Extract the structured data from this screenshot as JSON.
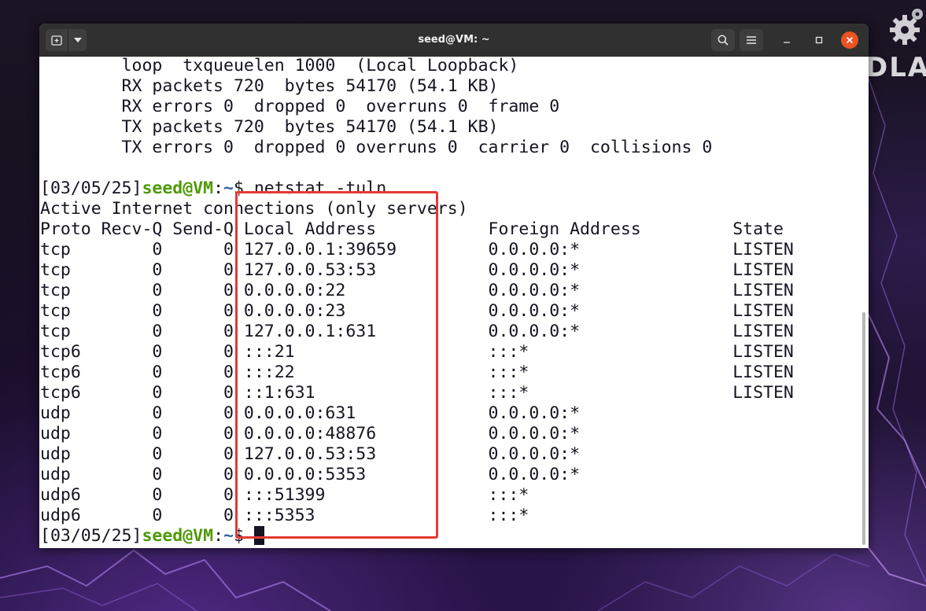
{
  "window": {
    "title": "seed@VM: ~"
  },
  "terminal": {
    "lines": [
      "        loop  txqueuelen 1000  (Local Loopback)",
      "        RX packets 720  bytes 54170 (54.1 KB)",
      "        RX errors 0  dropped 0  overruns 0  frame 0",
      "        TX packets 720  bytes 54170 (54.1 KB)",
      "        TX errors 0  dropped 0 overruns 0  carrier 0  collisions 0",
      "",
      "",
      "Active Internet connections (only servers)",
      "Proto Recv-Q Send-Q Local Address           Foreign Address         State",
      "tcp        0      0 127.0.0.1:39659         0.0.0.0:*               LISTEN",
      "tcp        0      0 127.0.0.53:53           0.0.0.0:*               LISTEN",
      "tcp        0      0 0.0.0.0:22              0.0.0.0:*               LISTEN",
      "tcp        0      0 0.0.0.0:23              0.0.0.0:*               LISTEN",
      "tcp        0      0 127.0.0.1:631           0.0.0.0:*               LISTEN",
      "tcp6       0      0 :::21                   :::*                    LISTEN",
      "tcp6       0      0 :::22                   :::*                    LISTEN",
      "tcp6       0      0 ::1:631                 :::*                    LISTEN",
      "udp        0      0 0.0.0.0:631             0.0.0.0:*",
      "udp        0      0 0.0.0.0:48876           0.0.0.0:*",
      "udp        0      0 127.0.0.53:53           0.0.0.0:*",
      "udp        0      0 0.0.0.0:5353            0.0.0.0:*",
      "udp6       0      0 :::51399                :::*",
      "udp6       0      0 :::5353                 :::*"
    ],
    "prompt_1": {
      "date": "[03/05/25]",
      "user": "seed@VM",
      "sep": ":",
      "path": "~",
      "dollar": "$ ",
      "command": "netstat -tuln"
    },
    "prompt_2": {
      "date": "[03/05/25]",
      "user": "seed@VM",
      "sep": ":",
      "path": "~",
      "dollar": "$ "
    }
  },
  "desktop_logo_text": "DLA",
  "colors": {
    "prompt_user": "#4e9a06",
    "prompt_path": "#3465a4",
    "highlight": "#e53935",
    "close_button": "#e95420"
  },
  "icons": [
    "new-tab-icon",
    "chevron-down-icon",
    "search-icon",
    "hamburger-menu-icon",
    "minimize-icon",
    "maximize-icon",
    "close-icon",
    "gear-icon"
  ]
}
